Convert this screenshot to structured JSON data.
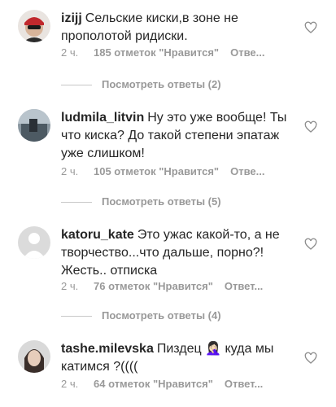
{
  "comments": [
    {
      "username": "izijj",
      "text": "Сельские киски,в зоне не прополотой ридиски.",
      "time": "2 ч.",
      "likes": "185 отметок \"Нравится\"",
      "reply": "Отве...",
      "view_replies": "Посмотреть ответы (2)"
    },
    {
      "username": "ludmila_litvin",
      "text": "Ну это уже вообще! Ты что киска? До такой степени эпатаж уже слишком!",
      "time": "2 ч.",
      "likes": "105 отметок \"Нравится\"",
      "reply": "Отве...",
      "view_replies": "Посмотреть ответы (5)"
    },
    {
      "username": "katoru_kate",
      "text": "Это ужас какой-то, а не творчество...что дальше, порно?! Жесть.. отписка",
      "time": "2 ч.",
      "likes": "76 отметок \"Нравится\"",
      "reply": "Ответ...",
      "view_replies": "Посмотреть ответы (4)"
    },
    {
      "username": "tashe.milevska",
      "text": "Пиздец 🤦🏻‍♀️ куда мы катимся ?((((",
      "time": "2 ч.",
      "likes": "64 отметок \"Нравится\"",
      "reply": "Ответ..."
    }
  ],
  "colors": {
    "text": "#262626",
    "secondary": "#999999",
    "divider": "#c7c7c7"
  },
  "icons": {
    "like": "heart-outline-icon"
  }
}
